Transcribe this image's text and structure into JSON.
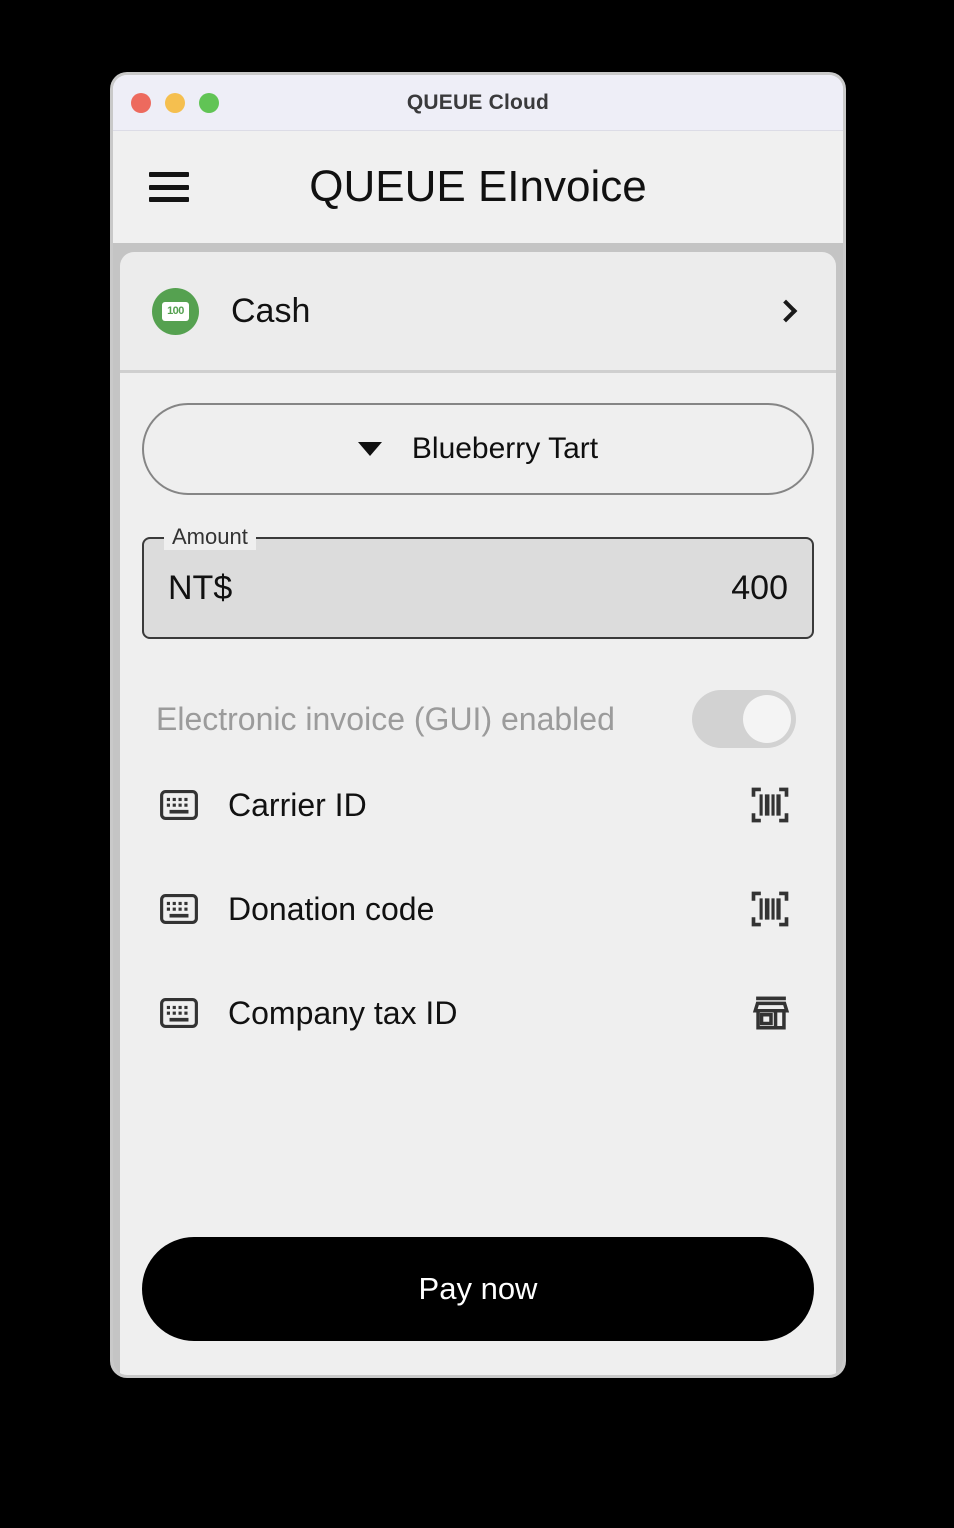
{
  "window": {
    "titlebar_title": "QUEUE Cloud",
    "traffic_lights": [
      {
        "name": "close",
        "color": "#ed6a5e"
      },
      {
        "name": "minimize",
        "color": "#f5bf4f"
      },
      {
        "name": "maximize",
        "color": "#61c455"
      }
    ]
  },
  "appbar": {
    "menu_icon": "hamburger-menu-icon",
    "title": "QUEUE EInvoice"
  },
  "payment_method": {
    "icon": "cash-banknote-icon",
    "icon_text": "100",
    "icon_color": "#55a150",
    "label": "Cash",
    "chevron": "chevron-right-icon"
  },
  "item_dropdown": {
    "caret": "chevron-down-icon",
    "value": "Blueberry Tart"
  },
  "amount": {
    "legend": "Amount",
    "currency_prefix": "NT$",
    "value": "400"
  },
  "einvoice_toggle": {
    "label": "Electronic invoice (GUI) enabled",
    "state": "on",
    "track_color": "#d2d2d2",
    "knob_color": "#f4f4f4"
  },
  "options": [
    {
      "left_icon": "keyboard-icon",
      "label": "Carrier ID",
      "right_icon": "barcode-scan-icon"
    },
    {
      "left_icon": "keyboard-icon",
      "label": "Donation code",
      "right_icon": "barcode-scan-icon"
    },
    {
      "left_icon": "keyboard-icon",
      "label": "Company tax ID",
      "right_icon": "storefront-icon"
    }
  ],
  "footer": {
    "pay_label": "Pay now",
    "pay_bg": "#000000"
  }
}
